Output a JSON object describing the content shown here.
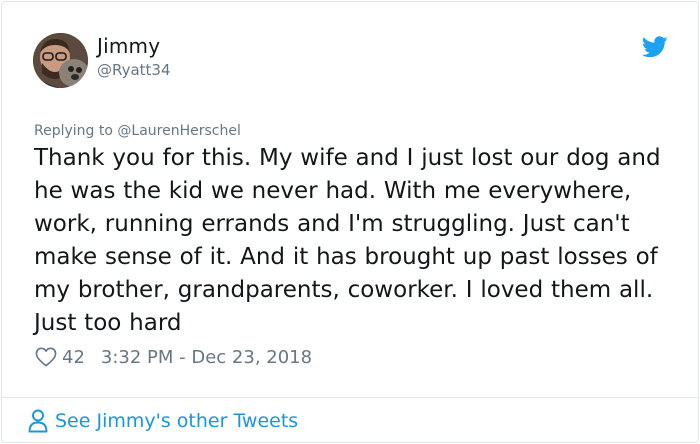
{
  "author": {
    "name": "Jimmy",
    "handle": "@Ryatt34"
  },
  "reply": {
    "prefix": "Replying to ",
    "mention": "@LaurenHerschel"
  },
  "tweet": {
    "text": "Thank you for this. My wife and I just lost our dog and he was the kid we never had. With me everywhere, work, running errands and I'm struggling. Just can't make sense of it. And it has brought up past losses of my brother, grandparents, coworker. I loved them all. Just too hard",
    "likes": "42",
    "timestamp": "3:32 PM - Dec 23, 2018"
  },
  "footer": {
    "see_more_label": "See Jimmy's other Tweets"
  },
  "icons": {
    "brand": "twitter-bird-icon",
    "like": "heart-icon",
    "profile": "person-icon"
  },
  "colors": {
    "brand_blue": "#1da1f2",
    "link_blue": "#1b95e0",
    "muted_gray": "#657786",
    "text": "#14171a",
    "border": "#e1e8ed"
  }
}
